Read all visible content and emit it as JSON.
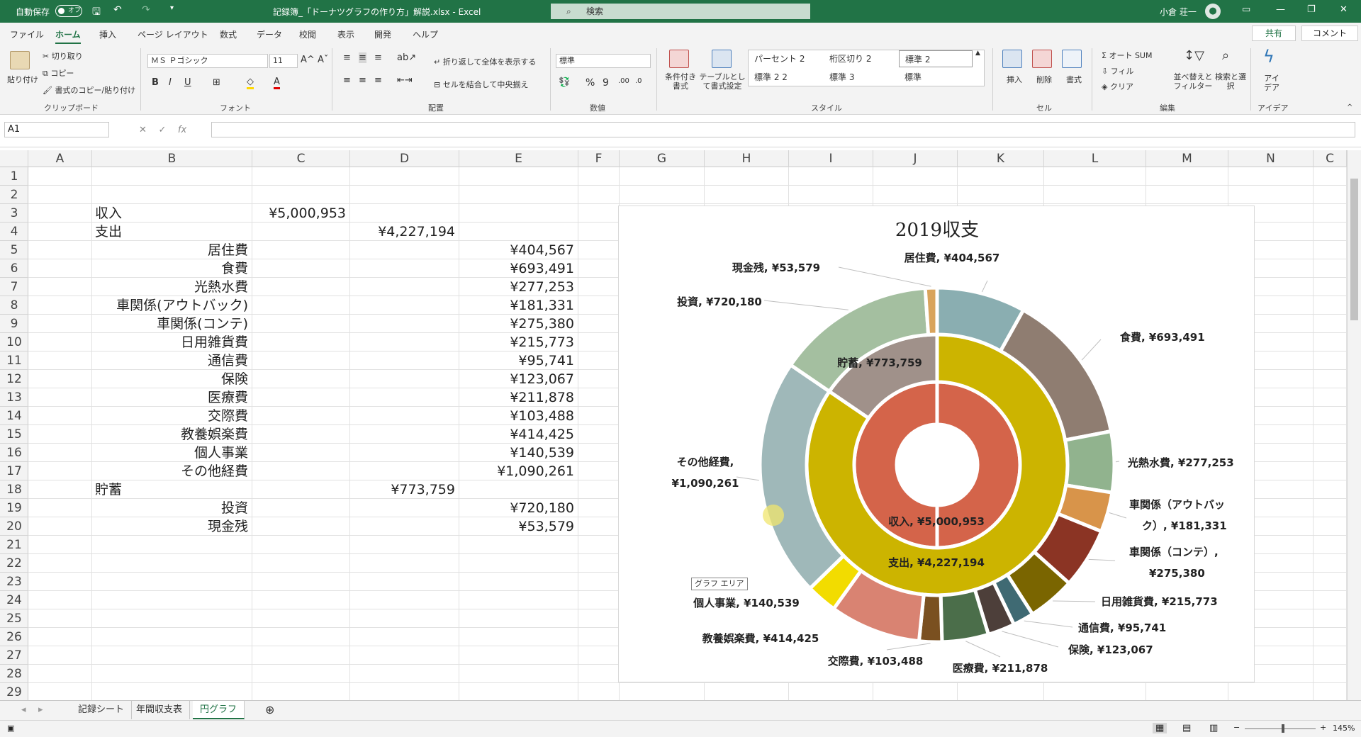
{
  "titlebar": {
    "autosave_label": "自動保存",
    "autosave_state": "オフ",
    "document_title": "記録簿_「ドーナツグラフの作り方」解説.xlsx  -  Excel",
    "search_placeholder": "検索",
    "user_name": "小倉 荘一"
  },
  "ribbon_tabs": [
    "ファイル",
    "ホーム",
    "挿入",
    "ページ レイアウト",
    "数式",
    "データ",
    "校閲",
    "表示",
    "開発",
    "ヘルプ"
  ],
  "share_label": "共有",
  "comment_label": "コメント",
  "ribbon": {
    "clipboard": {
      "paste": "貼り付け",
      "cut": "切り取り",
      "copy": "コピー",
      "format_painter": "書式のコピー/貼り付け",
      "label": "クリップボード"
    },
    "font": {
      "name": "ＭＳ Ｐゴシック",
      "size": "11",
      "label": "フォント"
    },
    "alignment": {
      "wrap": "折り返して全体を表示する",
      "merge": "セルを結合して中央揃え",
      "label": "配置"
    },
    "number": {
      "format": "標準",
      "label": "数値"
    },
    "styles": {
      "conditional": "条件付き書式",
      "table": "テーブルとして書式設定",
      "cells": [
        "パーセント 2",
        "桁区切り 2",
        "標準 2",
        "標準 2 2",
        "標準 3",
        "標準"
      ],
      "label": "スタイル"
    },
    "cells": {
      "insert": "挿入",
      "delete": "削除",
      "format": "書式",
      "label": "セル"
    },
    "editing": {
      "autosum": "オート SUM",
      "fill": "フィル",
      "clear": "クリア",
      "sort": "並べ替えとフィルター",
      "find": "検索と選択",
      "label": "編集"
    },
    "ideas": {
      "label": "アイデア",
      "button": "アイデア"
    }
  },
  "name_box": "A1",
  "columns": [
    "A",
    "B",
    "C",
    "D",
    "E",
    "F",
    "G",
    "H",
    "I",
    "J",
    "K",
    "L",
    "M",
    "N",
    "C"
  ],
  "rows": [
    "1",
    "2",
    "3",
    "4",
    "5",
    "6",
    "7",
    "8",
    "9",
    "10",
    "11",
    "12",
    "13",
    "14",
    "15",
    "16",
    "17",
    "18",
    "19",
    "20",
    "21",
    "22",
    "23",
    "24",
    "25",
    "26",
    "27",
    "28",
    "29"
  ],
  "table": [
    {
      "row": 3,
      "b": "収入",
      "c": "¥5,000,953",
      "d": "",
      "e": ""
    },
    {
      "row": 4,
      "b": "支出",
      "c": "",
      "d": "¥4,227,194",
      "e": ""
    },
    {
      "row": 5,
      "b": "居住費",
      "c": "",
      "d": "",
      "e": "¥404,567"
    },
    {
      "row": 6,
      "b": "食費",
      "c": "",
      "d": "",
      "e": "¥693,491"
    },
    {
      "row": 7,
      "b": "光熱水費",
      "c": "",
      "d": "",
      "e": "¥277,253"
    },
    {
      "row": 8,
      "b": "車関係(アウトバック)",
      "c": "",
      "d": "",
      "e": "¥181,331"
    },
    {
      "row": 9,
      "b": "車関係(コンテ)",
      "c": "",
      "d": "",
      "e": "¥275,380"
    },
    {
      "row": 10,
      "b": "日用雑貨費",
      "c": "",
      "d": "",
      "e": "¥215,773"
    },
    {
      "row": 11,
      "b": "通信費",
      "c": "",
      "d": "",
      "e": "¥95,741"
    },
    {
      "row": 12,
      "b": "保険",
      "c": "",
      "d": "",
      "e": "¥123,067"
    },
    {
      "row": 13,
      "b": "医療費",
      "c": "",
      "d": "",
      "e": "¥211,878"
    },
    {
      "row": 14,
      "b": "交際費",
      "c": "",
      "d": "",
      "e": "¥103,488"
    },
    {
      "row": 15,
      "b": "教養娯楽費",
      "c": "",
      "d": "",
      "e": "¥414,425"
    },
    {
      "row": 16,
      "b": "個人事業",
      "c": "",
      "d": "",
      "e": "¥140,539"
    },
    {
      "row": 17,
      "b": "その他経費",
      "c": "",
      "d": "",
      "e": "¥1,090,261"
    },
    {
      "row": 18,
      "b": "貯蓄",
      "c": "",
      "d": "¥773,759",
      "e": ""
    },
    {
      "row": 19,
      "b": "投資",
      "c": "",
      "d": "",
      "e": "¥720,180"
    },
    {
      "row": 20,
      "b": "現金残",
      "c": "",
      "d": "",
      "e": "¥53,579"
    }
  ],
  "chart_data": {
    "type": "donut",
    "title": "2019収支",
    "rings": [
      {
        "name": "",
        "labels": [
          "収入"
        ],
        "values": [
          5000953
        ],
        "colors": [
          "#d4644a"
        ]
      },
      {
        "name": "",
        "labels": [
          "支出",
          "貯蓄"
        ],
        "values": [
          4227194,
          773759
        ],
        "colors": [
          "#ccb400",
          "#a0918a"
        ]
      },
      {
        "name": "",
        "labels": [
          "居住費",
          "食費",
          "光熱水費",
          "車関係（アウトバック）",
          "車関係（コンテ）",
          "日用雑貨費",
          "通信費",
          "保険",
          "医療費",
          "交際費",
          "教養娯楽費",
          "個人事業",
          "その他経費",
          "投資",
          "現金残"
        ],
        "values": [
          404567,
          693491,
          277253,
          181331,
          275380,
          215773,
          95741,
          123067,
          211878,
          103488,
          414425,
          140539,
          1090261,
          720180,
          53579
        ],
        "colors": [
          "#8aaeb1",
          "#8f7d71",
          "#91b38e",
          "#d8944a",
          "#8b3424",
          "#7a6500",
          "#3f6a73",
          "#4d3f3a",
          "#4b6e4a",
          "#7a5020",
          "#d98372",
          "#f2dc00",
          "#9fb8b9",
          "#a4bfa0",
          "#d9a45c"
        ]
      }
    ],
    "data_labels": [
      {
        "text": "居住費, ¥404,567"
      },
      {
        "text": "食費, ¥693,491"
      },
      {
        "text": "光熱水費, ¥277,253"
      },
      {
        "text": "車関係（アウトバック）, ¥181,331"
      },
      {
        "text": "車関係（コンテ）, ¥275,380"
      },
      {
        "text": "日用雑貨費, ¥215,773"
      },
      {
        "text": "通信費, ¥95,741"
      },
      {
        "text": "保険, ¥123,067"
      },
      {
        "text": "医療費, ¥211,878"
      },
      {
        "text": "交際費, ¥103,488"
      },
      {
        "text": "教養娯楽費, ¥414,425"
      },
      {
        "text": "個人事業, ¥140,539"
      },
      {
        "text": "その他経費, ¥1,090,261"
      },
      {
        "text": "投資, ¥720,180"
      },
      {
        "text": "現金残, ¥53,579"
      },
      {
        "text": "貯蓄, ¥773,759"
      },
      {
        "text": "支出, ¥4,227,194"
      },
      {
        "text": "収入, ¥5,000,953"
      }
    ]
  },
  "chart_tooltip": "グラフ エリア",
  "sheet_tabs": [
    "記録シート",
    "年間収支表",
    "円グラフ"
  ],
  "active_sheet": "円グラフ",
  "zoom": "145%"
}
